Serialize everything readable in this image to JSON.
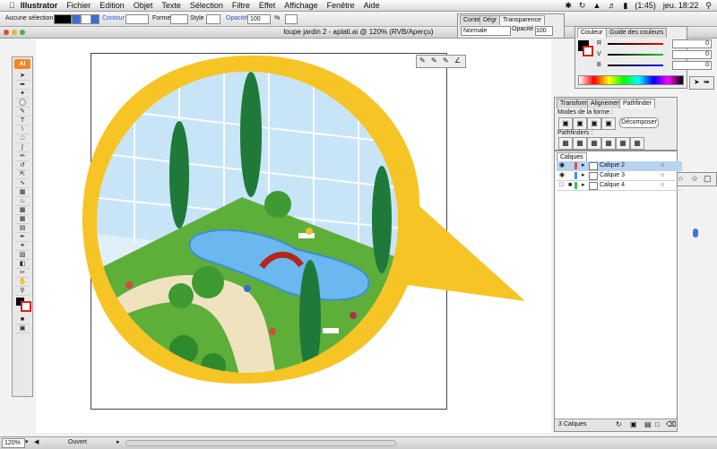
{
  "menubar": {
    "apple": "",
    "app_name": "Illustrator",
    "items": [
      "Fichier",
      "Edition",
      "Objet",
      "Texte",
      "Sélection",
      "Filtre",
      "Effet",
      "Affichage",
      "Fenêtre",
      "Aide"
    ],
    "battery": "(1:45)",
    "clock": "jeu. 18:22"
  },
  "control_bar": {
    "selection_label": "Aucune sélection",
    "contour_label": "Contour :",
    "forme_label": "Forme :",
    "style_label": "Style :",
    "opacity_label": "Opacité :",
    "opacity_value": "100",
    "percent": "%"
  },
  "document": {
    "title": "loupe jardin 2 - aplati.ai @ 120% (RVB/Aperçu)"
  },
  "tools": {
    "logo": "Ai",
    "icons": [
      "selection-arrow",
      "direct-select",
      "magic-wand",
      "lasso",
      "pen",
      "type",
      "line",
      "rectangle",
      "paintbrush",
      "pencil",
      "rotate",
      "scale",
      "warp",
      "free-transform",
      "symbol-sprayer",
      "graph",
      "mesh",
      "gradient",
      "eyedropper",
      "blend",
      "live-paint",
      "scissors",
      "hand",
      "zoom"
    ]
  },
  "transparency_panel": {
    "tabs": [
      "Conte",
      "Dégr",
      "Transparence"
    ],
    "mode": "Normale",
    "opacity_label": "Opacité :",
    "opacity_value": "100"
  },
  "color_panel": {
    "tabs": [
      "Couleur",
      "Guide des couleurs"
    ],
    "channels": [
      {
        "label": "R",
        "value": "0",
        "color": "#d83030"
      },
      {
        "label": "V",
        "value": "0",
        "color": "#2faa2f"
      },
      {
        "label": "B",
        "value": "0",
        "color": "#3050d8"
      }
    ]
  },
  "pathfinder_panel": {
    "tabs": [
      "Transform",
      "Alignement",
      "Pathfinder"
    ],
    "modes_label": "Modes de la forme :",
    "decompose_label": "Décomposer",
    "pathfinders_label": "Pathfinders :"
  },
  "layers_panel": {
    "tab": "Calques",
    "layers": [
      {
        "name": "Calque 2",
        "color": "#e85050",
        "selected": true
      },
      {
        "name": "Calque 3",
        "color": "#4a8cf0",
        "selected": false
      },
      {
        "name": "Calque 4",
        "color": "#3cc44a",
        "selected": false
      }
    ],
    "count": "3 Calques"
  },
  "status": {
    "zoom": "120%",
    "state": "Ouvert"
  },
  "colors": {
    "bubble_yellow": "#f6c424",
    "grass": "#5eae3a",
    "water": "#6bb8f0",
    "tree": "#1f7a3a",
    "accent_orange": "#f3861e"
  }
}
